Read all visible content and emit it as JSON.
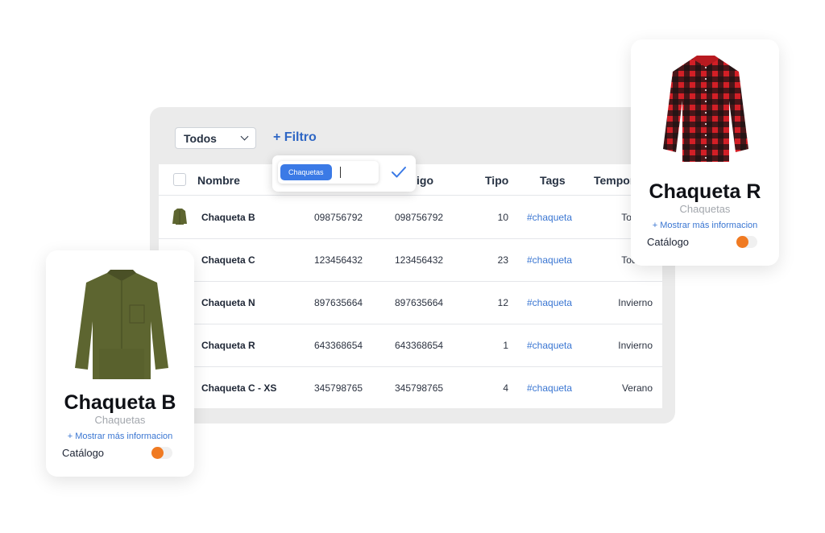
{
  "toolbar": {
    "dropdown_value": "Todos",
    "filter_label": "+ Filtro"
  },
  "filter_popup": {
    "chip": "Chaquetas"
  },
  "table": {
    "headers": [
      "Nombre",
      "igo",
      "Tipo",
      "Tags",
      "Tempor"
    ],
    "rows": [
      {
        "name": "Chaqueta B",
        "code1": "098756792",
        "code2": "098756792",
        "tipo": "10",
        "tag": "#chaqueta",
        "temp": "Todo el"
      },
      {
        "name": "Chaqueta C",
        "code1": "123456432",
        "code2": "123456432",
        "tipo": "23",
        "tag": "#chaqueta",
        "temp": "Todo el"
      },
      {
        "name": "Chaqueta N",
        "code1": "897635664",
        "code2": "897635664",
        "tipo": "12",
        "tag": "#chaqueta",
        "temp": "Invierno"
      },
      {
        "name": "Chaqueta R",
        "code1": "643368654",
        "code2": "643368654",
        "tipo": "1",
        "tag": "#chaqueta",
        "temp": "Invierno"
      },
      {
        "name": "Chaqueta C - XS",
        "code1": "345798765",
        "code2": "345798765",
        "tipo": "4",
        "tag": "#chaqueta",
        "temp": "Verano"
      }
    ]
  },
  "card_r": {
    "title": "Chaqueta R",
    "subtitle": "Chaquetas",
    "more": "+ Mostrar más informacion",
    "catalog_label": "Catálogo"
  },
  "card_b": {
    "title": "Chaqueta B",
    "subtitle": "Chaquetas",
    "more": "+ Mostrar más informacion",
    "catalog_label": "Catálogo"
  },
  "colors": {
    "accent": "#3b7ae6",
    "toggle": "#f07a22",
    "link": "#3a76d2",
    "jacket_green": "#5d6530",
    "shirt_red": "#d21f26"
  }
}
